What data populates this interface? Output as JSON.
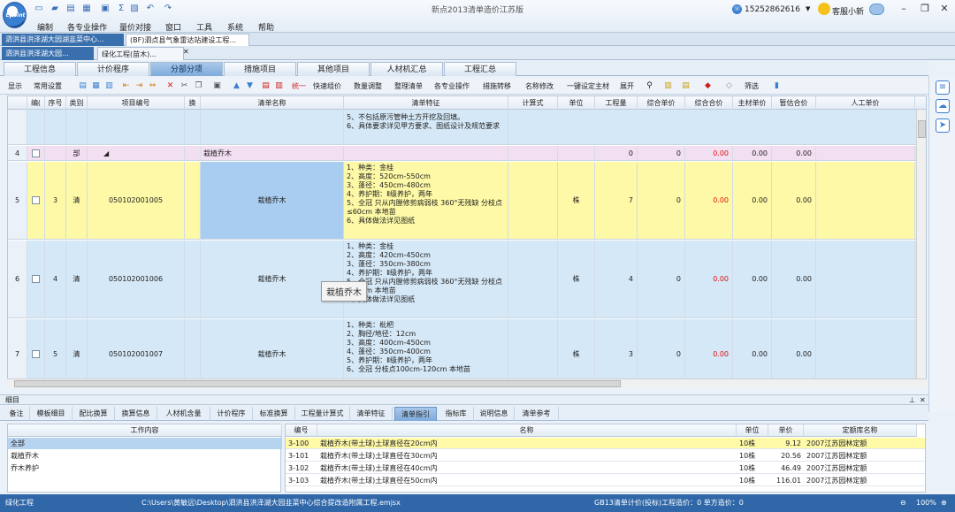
{
  "window": {
    "title": "新点2013清单造价江苏版",
    "phone": "15252862616",
    "service": "客服小新"
  },
  "menu": [
    "编制",
    "各专业操作",
    "量价对接",
    "窗口",
    "工具",
    "系统",
    "帮助"
  ],
  "doc_tabs": [
    "泗洪县洪泽湖大园湖韭菜中心...",
    "(BF)泗点县气象雷达站建设工程..."
  ],
  "sub_tabs": [
    "泗洪县洪泽湖大园...",
    "绿化工程(苗木)..."
  ],
  "main_tabs": [
    "工程信息",
    "计价程序",
    "分部分项",
    "措施项目",
    "其他项目",
    "人材机汇总",
    "工程汇总"
  ],
  "toolbar": [
    "显示",
    "常用设置",
    "统一",
    "快速组价",
    "数量调整",
    "整理清单",
    "各专业操作",
    "措施转移",
    "名称修改",
    "一键设定主材",
    "展开",
    "筛选"
  ],
  "grid": {
    "headers": [
      "编(",
      "序号",
      "类别",
      "项目编号",
      "换",
      "清单名称",
      "清单特征",
      "计算式",
      "单位",
      "工程量",
      "综合单价",
      "综合合价",
      "主材单价",
      "暂估合价",
      "人工单价"
    ],
    "row0_feature": "5、不包括原污管种土方开挖及回填。\n6、具体要求详见甲方要求、图纸设计及规范要求",
    "rows": [
      {
        "num": "4",
        "seq": "",
        "type": "部",
        "code": "",
        "name": "栽植乔木",
        "feature": "",
        "unit": "",
        "qty": "0",
        "unit_price": "0",
        "total": "0.00",
        "main_price": "0.00",
        "est_total": "0.00"
      },
      {
        "num": "5",
        "seq": "3",
        "type": "清",
        "code": "050102001005",
        "name": "栽植乔木",
        "feature": "1、种类：金桂\n2、高度：520cm-550cm\n3、蓬径：450cm-480cm\n4、养护期：Ⅱ级养护，两年\n5、全冠 只从内膛修剪病弱枝 360°无残缺 分枝点≤60cm 本地苗\n6、具体做法详见图纸",
        "unit": "株",
        "qty": "7",
        "unit_price": "0",
        "total": "0.00",
        "main_price": "0.00",
        "est_total": "0.00"
      },
      {
        "num": "6",
        "seq": "4",
        "type": "清",
        "code": "050102001006",
        "name": "栽植乔木",
        "feature": "1、种类：金桂\n2、高度：420cm-450cm\n3、蓬径：350cm-380cm\n4、养护期：Ⅱ级养护，两年\n5、全冠 只从内膛修剪病弱枝 360°无残缺 分枝点≤60cm 本地苗\n6、具体做法详见图纸",
        "unit": "株",
        "qty": "4",
        "unit_price": "0",
        "total": "0.00",
        "main_price": "0.00",
        "est_total": "0.00"
      },
      {
        "num": "7",
        "seq": "5",
        "type": "清",
        "code": "050102001007",
        "name": "栽植乔木",
        "feature": "1、种类：枇杷\n2、胸径/地径：12cm\n3、高度：400cm-450cm\n4、蓬径：350cm-400cm\n5、养护期：Ⅱ级养护，两年\n6、全冠 分枝点100cm-120cm 本地苗",
        "unit": "株",
        "qty": "3",
        "unit_price": "0",
        "total": "0.00",
        "main_price": "0.00",
        "est_total": "0.00"
      }
    ]
  },
  "tooltip": "栽植乔木",
  "splitter_label": "细目",
  "bottom_tabs": [
    "备注",
    "模板细目",
    "配比换算",
    "换算信息",
    "人材机含量",
    "计价程序",
    "标准换算",
    "工程量计算式",
    "清单特征",
    "清单指引",
    "指标库",
    "说明信息",
    "清单参考"
  ],
  "left_panel": {
    "header": "工作内容",
    "items": [
      "全部",
      "栽植乔木",
      "乔木养护"
    ]
  },
  "right_panel": {
    "headers": [
      "编号",
      "名称",
      "单位",
      "单价",
      "定额库名称"
    ],
    "rows": [
      {
        "code": "3-100",
        "name": "栽植乔木(带土球)土球直径在20cm内",
        "unit": "10株",
        "price": "9.12",
        "lib": "2007江苏园林定额"
      },
      {
        "code": "3-101",
        "name": "栽植乔木(带土球)土球直径在30cm内",
        "unit": "10株",
        "price": "20.56",
        "lib": "2007江苏园林定额"
      },
      {
        "code": "3-102",
        "name": "栽植乔木(带土球)土球直径在40cm内",
        "unit": "10株",
        "price": "46.49",
        "lib": "2007江苏园林定额"
      },
      {
        "code": "3-103",
        "name": "栽植乔木(带土球)土球直径在50cm内",
        "unit": "10株",
        "price": "116.01",
        "lib": "2007江苏园林定额"
      }
    ]
  },
  "status": {
    "left": "绿化工程",
    "path": "C:\\Users\\黄敏远\\Desktop\\泗洪县洪泽湖大园韭菜中心综合提改造附属工程.emjsx",
    "right": "GB13清单计价(投标)工程造价：0 单方造价：0",
    "zoom": "100%"
  }
}
